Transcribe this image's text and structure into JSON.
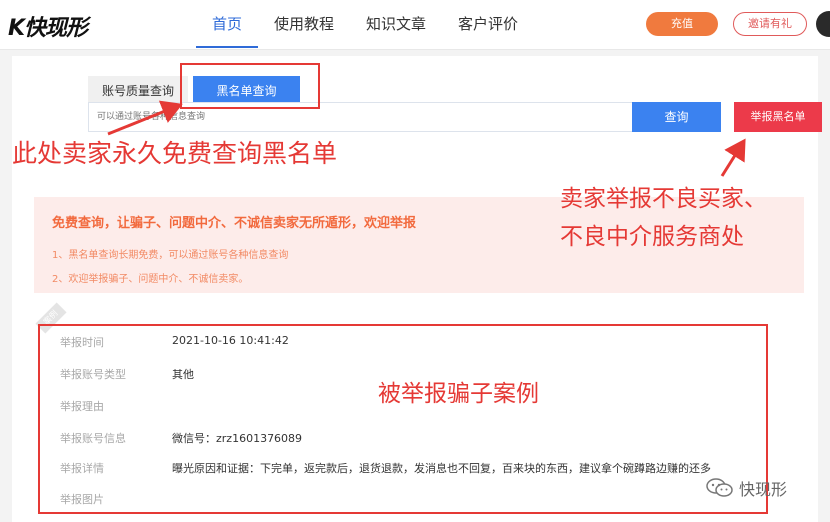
{
  "header": {
    "logo": "K快现形",
    "nav": [
      {
        "label": "首页",
        "active": true
      },
      {
        "label": "使用教程",
        "active": false
      },
      {
        "label": "知识文章",
        "active": false
      },
      {
        "label": "客户评价",
        "active": false
      }
    ],
    "recharge_label": "充值",
    "invite_label": "邀请有礼"
  },
  "search": {
    "tab_quality": "账号质量查询",
    "tab_blacklist": "黑名单查询",
    "placeholder": "可以通过账号各种信息查询",
    "query_label": "查询",
    "report_label": "举报黑名单"
  },
  "notice": {
    "title": "免费查询，让骗子、问题中介、不诚信卖家无所遁形，欢迎举报",
    "line1": "1、黑名单查询长期免费，可以通过账号各种信息查询",
    "line2": "2、欢迎举报骗子、问题中介、不诚信卖家。"
  },
  "case_ribbon": "案例",
  "case": {
    "rows": [
      {
        "label": "举报时间",
        "value": "2021-10-16 10:41:42"
      },
      {
        "label": "举报账号类型",
        "value": "其他"
      },
      {
        "label": "举报理由",
        "value": ""
      },
      {
        "label": "举报账号信息",
        "value": "微信号：zrz1601376089"
      },
      {
        "label": "举报详情",
        "value": "曝光原因和证据：下完单，返完款后，退货退款，发消息也不回复，百来块的东西，建议拿个碗蹲路边赚的还多"
      },
      {
        "label": "举报图片",
        "value": ""
      }
    ]
  },
  "annotations": {
    "free_query": "此处卖家永久免费查询黑名单",
    "report_line1": "卖家举报不良买家、",
    "report_line2": "不良中介服务商处",
    "case_example": "被举报骗子案例"
  },
  "watermark": "快现形",
  "colors": {
    "primary": "#3b82f0",
    "report": "#ec3a4a",
    "recharge": "#f07a3e",
    "annotation": "#e53935",
    "notice_bg": "#fdecea"
  }
}
